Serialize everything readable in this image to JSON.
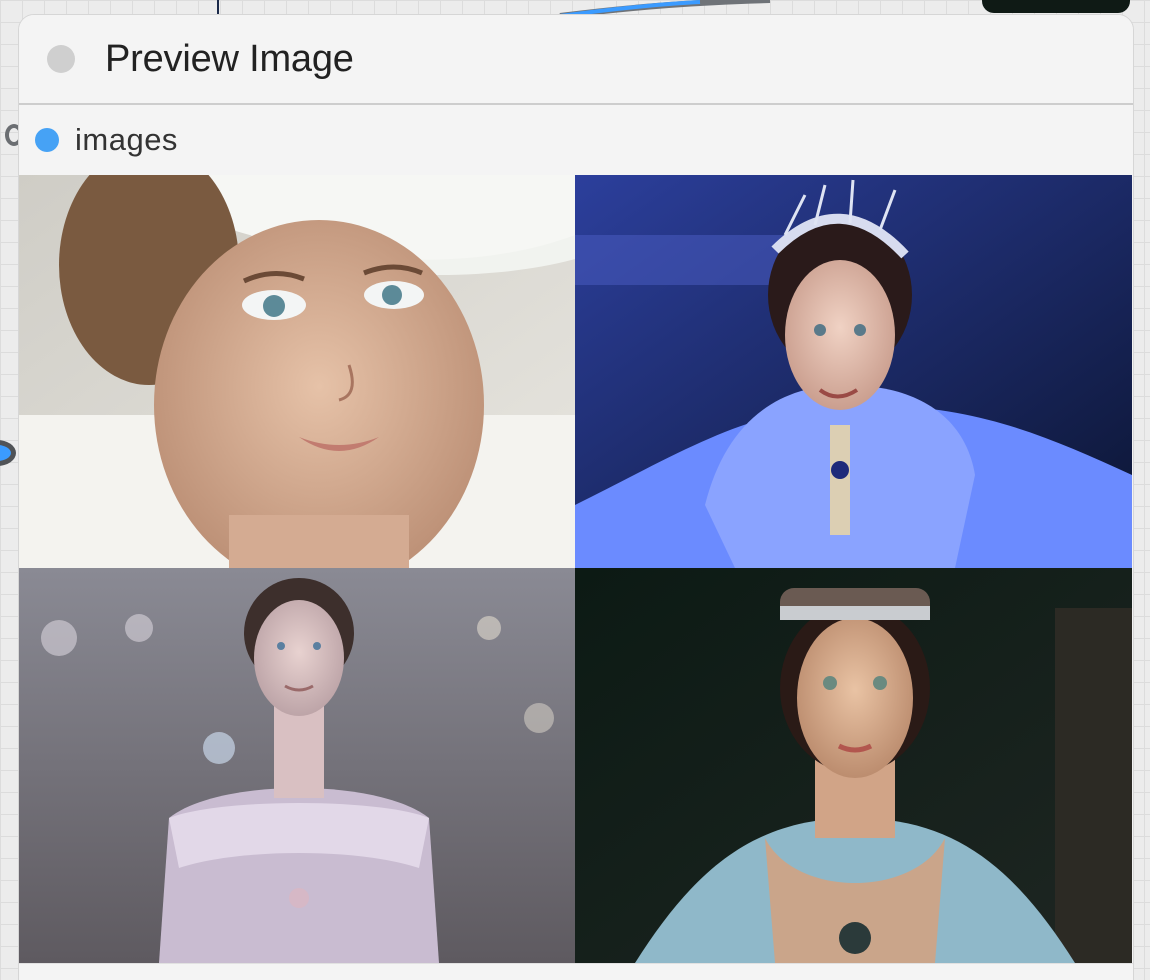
{
  "node": {
    "title": "Preview Image",
    "input_slot": {
      "label": "images",
      "color": "#46a2f5"
    }
  },
  "images": [
    {
      "name": "portrait-white-hat"
    },
    {
      "name": "portrait-blue-tiara"
    },
    {
      "name": "portrait-lilac-dress"
    },
    {
      "name": "portrait-crown-dark"
    }
  ]
}
